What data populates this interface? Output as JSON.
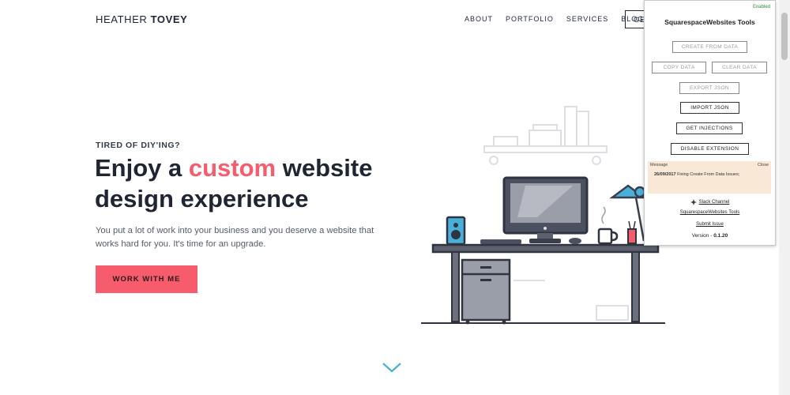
{
  "site": {
    "logo_first": "HEATHER",
    "logo_last": "TOVEY",
    "nav": [
      "ABOUT",
      "PORTFOLIO",
      "SERVICES",
      "BLOG"
    ],
    "cta_partial": "GET"
  },
  "hero": {
    "eyebrow": "TIRED OF DIY'ING?",
    "headline_pre": "Enjoy a ",
    "headline_accent": "custom",
    "headline_post": " website design experience",
    "subtext": "You put a lot of work into your business and you deserve a website that works hard for you. It's time for an upgrade.",
    "cta": "WORK WITH ME",
    "accent_color": "#f65c6c"
  },
  "extension": {
    "status": "Enabled",
    "title": "SquarespaceWebsites Tools",
    "buttons": {
      "create": "CREATE FROM DATA",
      "copy": "COPY DATA",
      "clear": "CLEAR DATA",
      "export": "EXPORT JSON",
      "import": "IMPORT JSON",
      "injections": "GET INJECTIONS",
      "disable": "DISABLE EXTENSION"
    },
    "message": {
      "label": "Message",
      "close": "Close",
      "date": "26/09/2017",
      "text": "Fixing Create From Data Issues;"
    },
    "links": {
      "slack": "Slack Channel",
      "tools": "SquarespaceWebsites Tools",
      "issue": "Submit Issue"
    },
    "version_label": "Version - ",
    "version": "0.1.20"
  }
}
